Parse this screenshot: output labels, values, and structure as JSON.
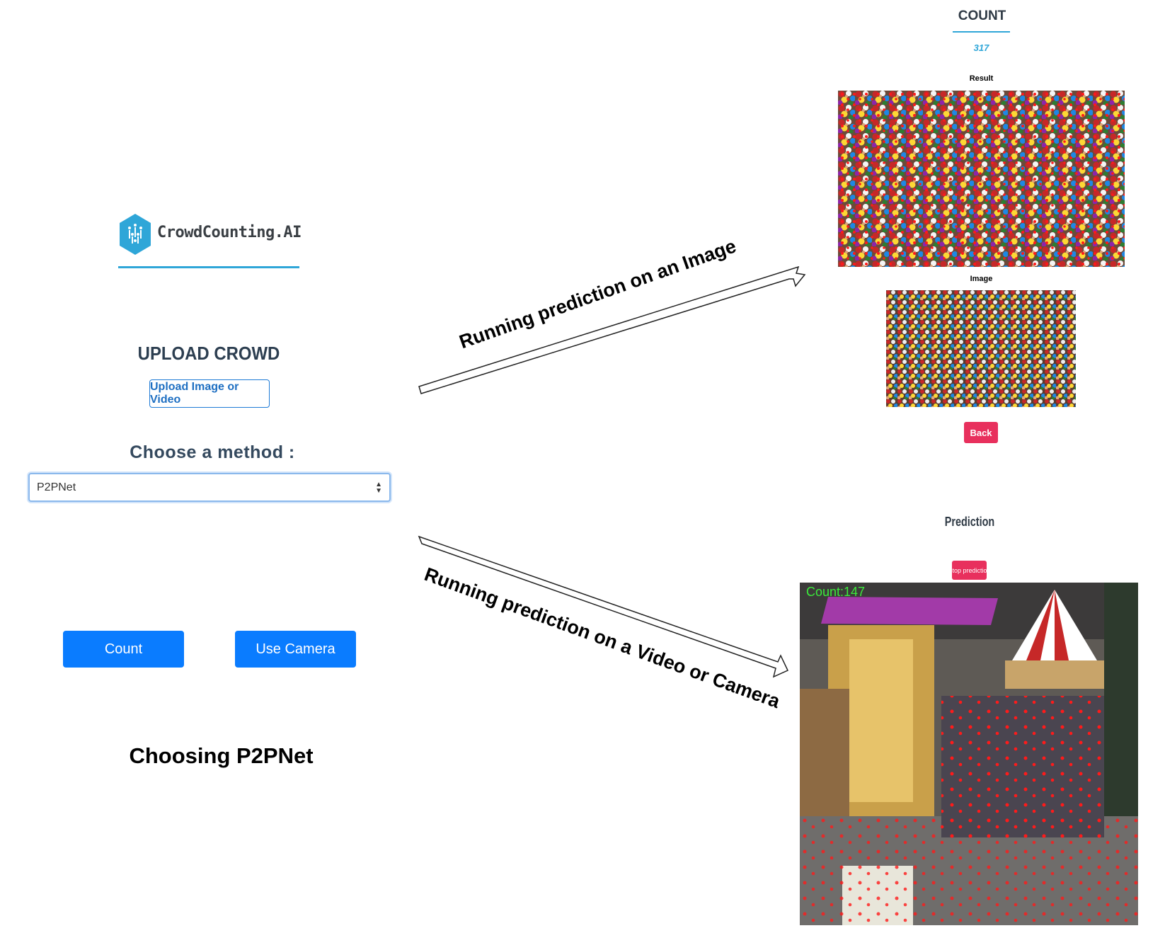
{
  "logo": {
    "brand_text": "CrowdCounting.AI",
    "icon": "crowd-hexagon-icon",
    "color": "#2fa6d8"
  },
  "upload": {
    "title": "UPLOAD CROWD",
    "button_label": "Upload Image or Video"
  },
  "method": {
    "title": "Choose a method :",
    "selected": "P2PNet"
  },
  "actions": {
    "count_label": "Count",
    "camera_label": "Use Camera"
  },
  "caption": "Choosing P2PNet",
  "arrows": {
    "image_label": "Running prediction on an Image",
    "video_label": "Running prediction on a Video or Camera"
  },
  "result_page": {
    "count_title": "COUNT",
    "count_value": "317",
    "result_label": "Result",
    "image_label": "Image",
    "back_label": "Back"
  },
  "video_page": {
    "title": "Prediction",
    "stop_label": "Stop prediction",
    "overlay_count": "Count:147"
  },
  "colors": {
    "primary": "#0a7cff",
    "accent": "#2fa6d8",
    "danger": "#e8305d"
  }
}
